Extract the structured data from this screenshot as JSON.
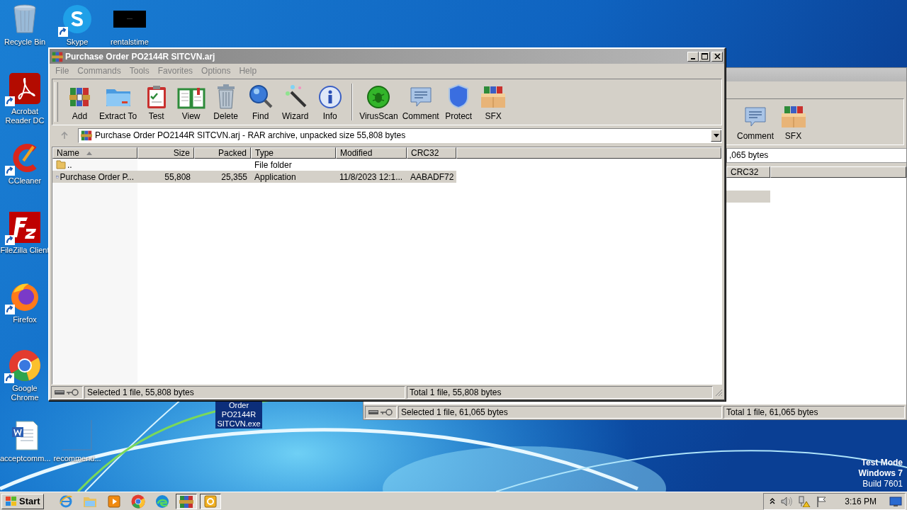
{
  "desktop": {
    "icons": [
      {
        "label": "Recycle Bin",
        "kind": "recycle",
        "shortcut": false,
        "selected": false
      },
      {
        "label": "Skype",
        "kind": "skype",
        "shortcut": true,
        "selected": false
      },
      {
        "label": "rentalstime",
        "kind": "thumbnail",
        "shortcut": false,
        "selected": false
      },
      {
        "label": "Acrobat Reader DC",
        "kind": "acrobat",
        "shortcut": true,
        "selected": false
      },
      {
        "label": "CCleaner",
        "kind": "ccleaner",
        "shortcut": true,
        "selected": false
      },
      {
        "label": "FileZilla Client",
        "kind": "filezilla",
        "shortcut": true,
        "selected": false
      },
      {
        "label": "Firefox",
        "kind": "firefox",
        "shortcut": true,
        "selected": false
      },
      {
        "label": "Google Chrome",
        "kind": "chrome",
        "shortcut": true,
        "selected": false
      },
      {
        "label": "acceptcomm...",
        "kind": "word",
        "shortcut": false,
        "selected": false
      },
      {
        "label": "recommend...",
        "kind": "blank",
        "shortcut": false,
        "selected": false
      },
      {
        "label": "Order PO2144R SITCVN.exe",
        "kind": "covered",
        "selected": true
      }
    ],
    "os_text": [
      "Test Mode",
      "Windows 7",
      "Build 7601"
    ]
  },
  "back_window": {
    "toolbar": [
      {
        "label": "Comment",
        "kind": "comment"
      },
      {
        "label": "SFX",
        "kind": "sfx"
      }
    ],
    "address": ",065 bytes",
    "columns": [
      {
        "label": "CRC32"
      }
    ],
    "rows": [
      {
        "selected": false
      },
      {
        "selected": true
      }
    ],
    "status": {
      "selected": "Selected 1 file, 61,065 bytes",
      "total": "Total 1 file, 61,065 bytes"
    }
  },
  "front_window": {
    "title": "Purchase Order PO2144R SITCVN.arj",
    "menu": [
      "File",
      "Commands",
      "Tools",
      "Favorites",
      "Options",
      "Help"
    ],
    "toolbar": [
      [
        {
          "label": "Add",
          "kind": "add"
        },
        {
          "label": "Extract To",
          "kind": "extract"
        },
        {
          "label": "Test",
          "kind": "test"
        },
        {
          "label": "View",
          "kind": "view"
        },
        {
          "label": "Delete",
          "kind": "delete"
        },
        {
          "label": "Find",
          "kind": "find"
        },
        {
          "label": "Wizard",
          "kind": "wizard"
        },
        {
          "label": "Info",
          "kind": "info"
        }
      ],
      [
        {
          "label": "VirusScan",
          "kind": "virusscan"
        },
        {
          "label": "Comment",
          "kind": "comment"
        },
        {
          "label": "Protect",
          "kind": "protect"
        },
        {
          "label": "SFX",
          "kind": "sfx"
        }
      ]
    ],
    "address": "Purchase Order PO2144R SITCVN.arj - RAR archive, unpacked size 55,808 bytes",
    "columns": [
      {
        "label": "Name",
        "sorted": true
      },
      {
        "label": "Size",
        "sorted": false
      },
      {
        "label": "Packed",
        "sorted": false
      },
      {
        "label": "Type",
        "sorted": false
      },
      {
        "label": "Modified",
        "sorted": false
      },
      {
        "label": "CRC32",
        "sorted": false
      }
    ],
    "rows": [
      {
        "kind": "folder",
        "name": "..",
        "type": "File folder",
        "selected": false
      },
      {
        "kind": "application",
        "name": "Purchase Order P...",
        "size": "55,808",
        "packed": "25,355",
        "type": "Application",
        "modified": "11/8/2023 12:1...",
        "crc32": "AABADF72",
        "selected": true
      }
    ],
    "status": {
      "selected": "Selected 1 file, 55,808 bytes",
      "total": "Total 1 file, 55,808 bytes"
    }
  },
  "taskbar": {
    "start": "Start",
    "apps": [
      {
        "kind": "ie",
        "selected": false
      },
      {
        "kind": "explorer",
        "selected": false
      },
      {
        "kind": "media",
        "selected": false
      },
      {
        "kind": "chrome",
        "selected": false
      },
      {
        "kind": "edge",
        "selected": false
      },
      {
        "kind": "winrar",
        "selected": true
      },
      {
        "kind": "orange",
        "selected": true
      }
    ],
    "clock": "3:16 PM"
  }
}
